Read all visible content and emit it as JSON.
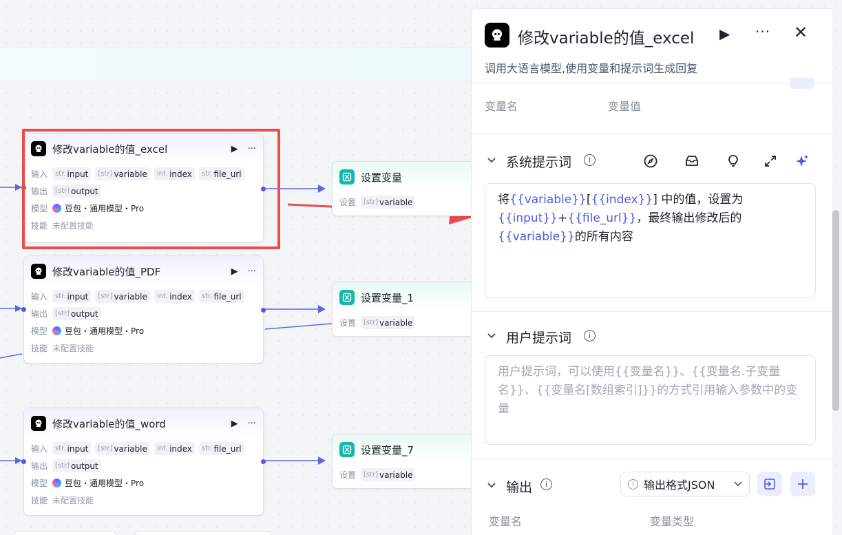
{
  "canvas": {
    "nodes": [
      {
        "title": "修改variable的值_excel",
        "labels": {
          "input": "输入",
          "output": "输出",
          "model": "模型",
          "skill": "技能"
        },
        "inputs": [
          {
            "type": "str.",
            "name": "input"
          },
          {
            "type": "[str]",
            "name": "variable"
          },
          {
            "type": "int.",
            "name": "index"
          },
          {
            "type": "str.",
            "name": "file_url"
          }
        ],
        "outputs": [
          {
            "type": "[str]",
            "name": "output"
          }
        ],
        "model": "豆包・通用模型・Pro",
        "skill": "未配置技能"
      },
      {
        "title": "修改variable的值_PDF",
        "labels": {
          "input": "输入",
          "output": "输出",
          "model": "模型",
          "skill": "技能"
        },
        "inputs": [
          {
            "type": "str.",
            "name": "input"
          },
          {
            "type": "[str]",
            "name": "variable"
          },
          {
            "type": "int.",
            "name": "index"
          },
          {
            "type": "str.",
            "name": "file_url"
          }
        ],
        "outputs": [
          {
            "type": "[str]",
            "name": "output"
          }
        ],
        "model": "豆包・通用模型・Pro",
        "skill": "未配置技能"
      },
      {
        "title": "修改variable的值_word",
        "labels": {
          "input": "输入",
          "output": "输出",
          "model": "模型",
          "skill": "技能"
        },
        "inputs": [
          {
            "type": "str.",
            "name": "input"
          },
          {
            "type": "[str]",
            "name": "variable"
          },
          {
            "type": "int.",
            "name": "index"
          },
          {
            "type": "str.",
            "name": "file_url"
          }
        ],
        "outputs": [
          {
            "type": "[str]",
            "name": "output"
          }
        ],
        "model": "豆包・通用模型・Pro",
        "skill": "未配置技能"
      }
    ],
    "set_nodes": [
      {
        "title": "设置变量",
        "label": "设置",
        "chip_type": "[str]",
        "chip_name": "variable"
      },
      {
        "title": "设置变量_1",
        "label": "设置",
        "chip_type": "[str]",
        "chip_name": "variable"
      },
      {
        "title": "设置变量_7",
        "label": "设置",
        "chip_type": "[str]",
        "chip_name": "variable"
      }
    ],
    "run_glyph": "▶",
    "more_glyph": "···"
  },
  "panel": {
    "title": "修改variable的值_excel",
    "description": "调用大语言模型,使用变量和提示词生成回复",
    "run_glyph": "▶",
    "more_glyph": "···",
    "close_glyph": "✕",
    "var_headers": {
      "name": "变量名",
      "value": "变量值"
    },
    "system_prompt": {
      "title": "系统提示词",
      "segments": [
        {
          "text": "将",
          "ref": false
        },
        {
          "text": "{{variable}}",
          "ref": true
        },
        {
          "text": "[",
          "ref": false
        },
        {
          "text": "{{index}}",
          "ref": true
        },
        {
          "text": "] 中的值，设置为",
          "ref": false
        },
        {
          "text": "{{input}}",
          "ref": true
        },
        {
          "text": "+",
          "ref": false
        },
        {
          "text": "{{file_url}}",
          "ref": true
        },
        {
          "text": "，最终输出修改后的",
          "ref": false
        },
        {
          "text": "{{variable}}",
          "ref": true
        },
        {
          "text": "的所有内容",
          "ref": false
        }
      ]
    },
    "user_prompt": {
      "title": "用户提示词",
      "placeholder": "用户提示词，可以使用{{变量名}}、{{变量名.子变量名}}、{{变量名[数组索引]}}的方式引用输入参数中的变量"
    },
    "output": {
      "title": "输出",
      "format_label": "输出格式JSON",
      "col_name": "变量名",
      "col_type": "变量类型"
    },
    "colors": {
      "accent": "#4e5be0",
      "highlight": "#ee4a4a",
      "teal": "#14b8a6"
    }
  }
}
